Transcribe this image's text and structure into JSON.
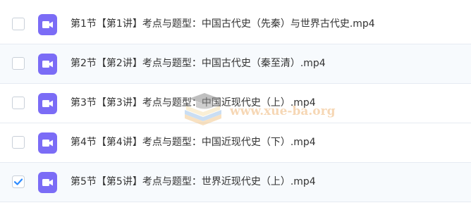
{
  "file_list": {
    "items": [
      {
        "name": "第1节【第1讲】考点与题型：中国古代史（先秦）与世界古代史.mp4",
        "checked": false,
        "icon": "video-file-icon"
      },
      {
        "name": "第2节【第2讲】考点与题型：中国古代史（秦至清）.mp4",
        "checked": false,
        "icon": "video-file-icon"
      },
      {
        "name": "第3节【第3讲】考点与题型：中国近现代史（上）.mp4",
        "checked": false,
        "icon": "video-file-icon"
      },
      {
        "name": "第4节【第4讲】考点与题型：中国近现代史（下）.mp4",
        "checked": false,
        "icon": "video-file-icon"
      },
      {
        "name": "第5节【第5讲】考点与题型：世界近现代史（上）.mp4",
        "checked": true,
        "icon": "video-file-icon"
      }
    ]
  },
  "watermark": {
    "text": "www.xue-ba.org",
    "icon": "graduation-cap-books-logo"
  },
  "colors": {
    "icon_purple": "#7b6cf6",
    "checkbox_checked": "#2f8cff",
    "row_alt_bg": "#f7fafd",
    "divider": "#e6ebf2",
    "text": "#333333"
  }
}
